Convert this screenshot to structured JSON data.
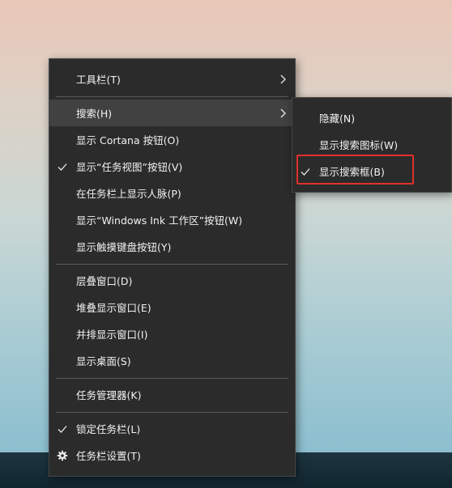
{
  "main_menu": {
    "toolbars": "工具栏(T)",
    "search": "搜索(H)",
    "show_cortana": "显示 Cortana 按钮(O)",
    "show_task_view": "显示“任务视图”按钮(V)",
    "show_people": "在任务栏上显示人脉(P)",
    "show_ink": "显示“Windows Ink 工作区”按钮(W)",
    "show_touch_keyboard": "显示触摸键盘按钮(Y)",
    "cascade": "层叠窗口(D)",
    "stacked": "堆叠显示窗口(E)",
    "side_by_side": "并排显示窗口(I)",
    "show_desktop": "显示桌面(S)",
    "task_manager": "任务管理器(K)",
    "lock_taskbar": "锁定任务栏(L)",
    "taskbar_settings": "任务栏设置(T)"
  },
  "sub_menu": {
    "hidden": "隐藏(N)",
    "show_search_icon": "显示搜索图标(W)",
    "show_search_box": "显示搜索框(B)"
  },
  "colors": {
    "menu_bg": "#2b2b2b",
    "hover_bg": "#414141",
    "text": "#f2f2f2",
    "highlight_border": "#e0312b"
  },
  "icons": {
    "check": "checkmark-icon",
    "submenu": "chevron-right-icon",
    "settings": "gear-icon"
  }
}
